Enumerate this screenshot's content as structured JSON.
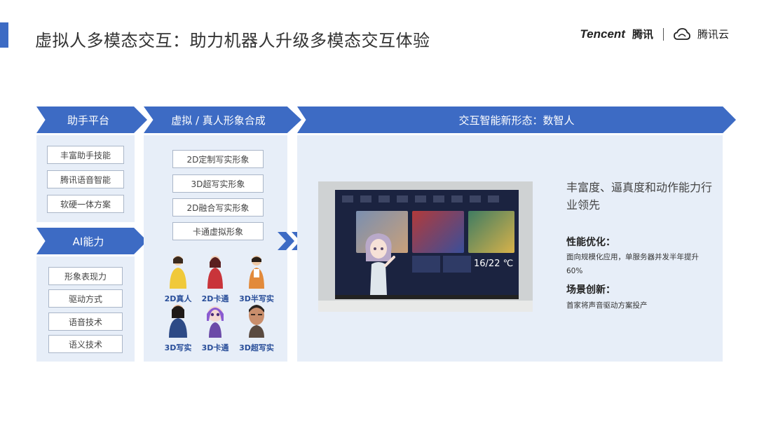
{
  "header": {
    "title": "虚拟人多模态交互：助力机器人升级多模态交互体验",
    "brand_en": "Tencent",
    "brand_cn": "腾讯",
    "cloud_cn": "腾讯云"
  },
  "sections": {
    "assistant_platform": {
      "label": "助手平台",
      "items": [
        "丰富助手技能",
        "腾讯语音智能",
        "软硬一体方案"
      ]
    },
    "ai_capability": {
      "label": "AI能力",
      "items": [
        "形象表现力",
        "驱动方式",
        "语音技术",
        "语义技术"
      ]
    },
    "synthesis": {
      "label": "虚拟 / 真人形象合成",
      "items": [
        "2D定制写实形象",
        "3D超写实形象",
        "2D融合写实形象",
        "卡通虚拟形象"
      ],
      "avatars": [
        "2D真人",
        "2D卡通",
        "3D半写实",
        "3D写实",
        "3D卡通",
        "3D超写实"
      ]
    },
    "digital_human": {
      "label": "交互智能新形态：数智人",
      "tv": {
        "temperature": "16/22 ℃"
      },
      "headline": "丰富度、逼真度和动作能力行业领先",
      "perf_title": "性能优化：",
      "perf_desc": "面向规模化应用，单服务器并发半年提升60%",
      "scene_title": "场景创新：",
      "scene_desc": "首家将声音驱动方案投产"
    }
  },
  "colors": {
    "accent": "#3d6bc4",
    "panel": "#e7eef8",
    "label_blue": "#2a4f9a"
  }
}
